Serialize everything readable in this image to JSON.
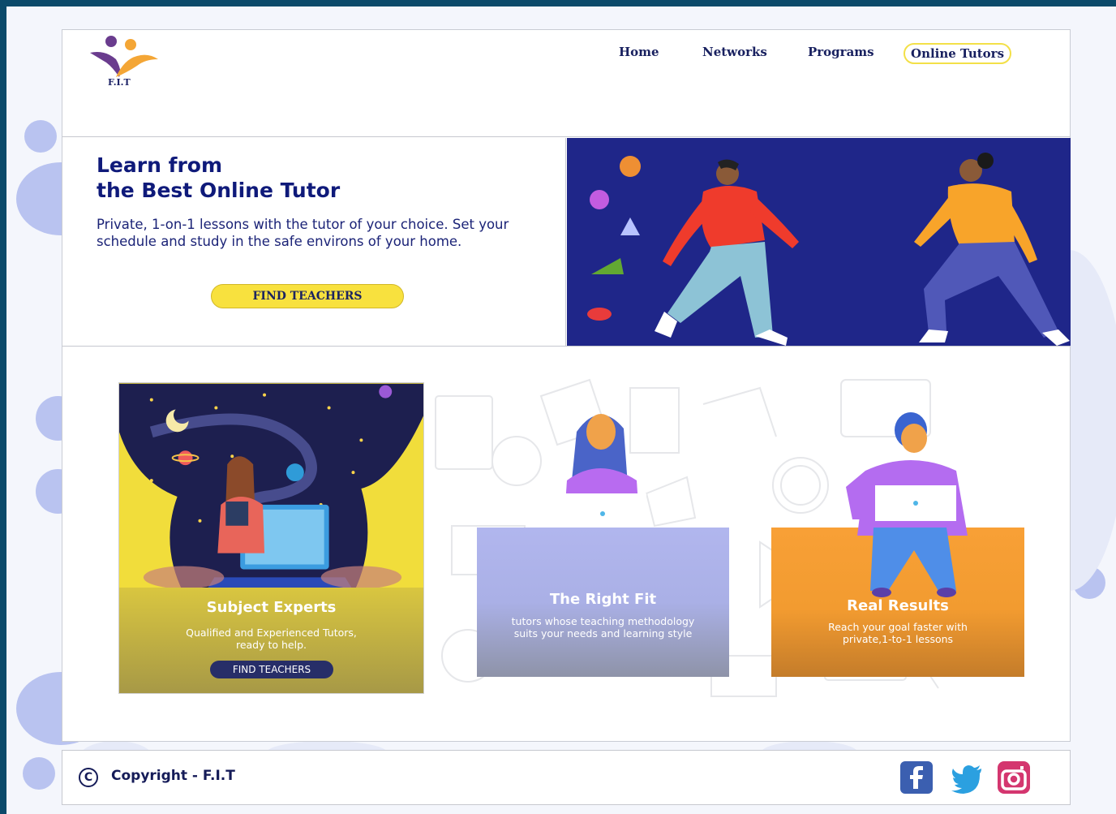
{
  "brand": {
    "logo_text": "F.I.T"
  },
  "nav": {
    "items": [
      {
        "label": "Home"
      },
      {
        "label": "Networks"
      },
      {
        "label": "Programs"
      },
      {
        "label": "Online Tutors",
        "active": true
      }
    ]
  },
  "hero": {
    "title_line1": "Learn from",
    "title_line2": "the Best Online Tutor",
    "description": "Private, 1-on-1 lessons with the tutor of your choice. Set your schedule and study in the safe environs of your home.",
    "cta_label": "FIND TEACHERS"
  },
  "features": [
    {
      "title": "Subject Experts",
      "text": "Qualified and Experienced Tutors, ready to help.",
      "cta_label": "FIND TEACHERS"
    },
    {
      "title": "The Right Fit",
      "text": "tutors whose teaching methodology suits your needs and learning style"
    },
    {
      "title": "Real Results",
      "text": "Reach your goal faster with private,1-to-1 lessons"
    }
  ],
  "footer": {
    "copyright_symbol": "C",
    "copyright_text": "Copyright - F.I.T",
    "social": [
      "facebook-icon",
      "twitter-icon",
      "instagram-icon"
    ]
  },
  "colors": {
    "frame": "#0b4a6a",
    "hero_panel": "#1f2689",
    "accent_yellow": "#f8e13e",
    "heading_blue": "#0f1a7a",
    "card_purple": "#b1b6ee",
    "card_orange": "#f8a036"
  }
}
